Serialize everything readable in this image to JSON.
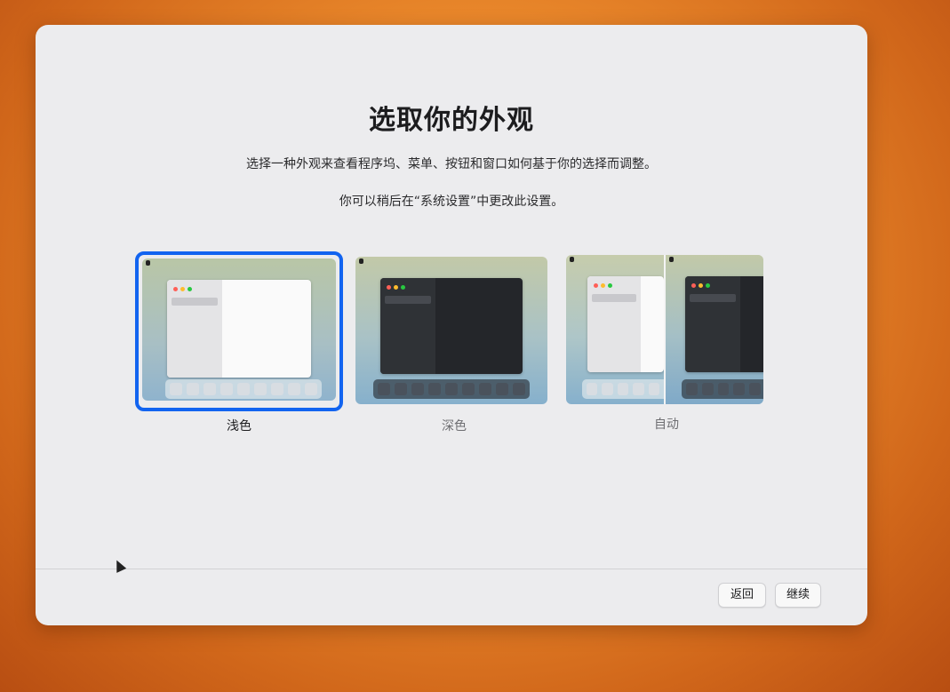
{
  "setup": {
    "title": "选取你的外观",
    "subtitle": "选择一种外观来查看程序坞、菜单、按钮和窗口如何基于你的选择而调整。",
    "note": "你可以稍后在“系统设置”中更改此设置。"
  },
  "options": [
    {
      "label": "浅色",
      "selected": true
    },
    {
      "label": "深色",
      "selected": false
    },
    {
      "label": "自动",
      "selected": false
    }
  ],
  "buttons": {
    "back": "返回",
    "continue": "继续"
  },
  "colors": {
    "accent": "#1264f0",
    "window_bg": "#ececee"
  }
}
